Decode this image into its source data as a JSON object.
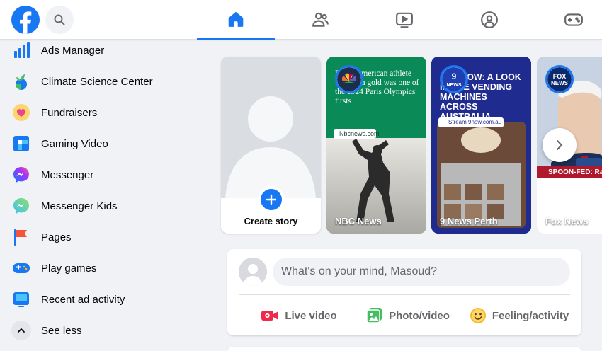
{
  "nav": {
    "tabs": [
      {
        "name": "home",
        "active": true,
        "icon": "home-icon"
      },
      {
        "name": "friends",
        "active": false,
        "icon": "friends-icon"
      },
      {
        "name": "watch",
        "active": false,
        "icon": "video-icon"
      },
      {
        "name": "groups",
        "active": false,
        "icon": "groups-icon"
      },
      {
        "name": "gaming",
        "active": false,
        "icon": "gamepad-icon"
      }
    ],
    "accent": "#1877f2"
  },
  "sidebar": {
    "items": [
      {
        "label": "Ads Manager",
        "icon": "ads-manager-icon"
      },
      {
        "label": "Climate Science Center",
        "icon": "climate-icon"
      },
      {
        "label": "Fundraisers",
        "icon": "fundraisers-icon"
      },
      {
        "label": "Gaming Video",
        "icon": "gaming-video-icon"
      },
      {
        "label": "Messenger",
        "icon": "messenger-icon"
      },
      {
        "label": "Messenger Kids",
        "icon": "messenger-kids-icon"
      },
      {
        "label": "Pages",
        "icon": "pages-flag-icon"
      },
      {
        "label": "Play games",
        "icon": "play-games-icon"
      },
      {
        "label": "Recent ad activity",
        "icon": "recent-ad-activity-icon"
      },
      {
        "label": "See less",
        "icon": "chevron-up-icon"
      }
    ]
  },
  "stories": {
    "create_label": "Create story",
    "items": [
      {
        "name": "NBC News",
        "headline": "Black American athlete who won gold was one of the 1924 Paris Olympics' firsts",
        "source": "Nbcnews.com"
      },
      {
        "name": "9 News Perth",
        "headline": "ON 9NOW: A LOOK INSIDE VENDING MACHINES ACROSS AUSTRALIA",
        "source": "Stream 9now.com.au"
      },
      {
        "name": "Fox News",
        "headline": "SPOON-FED: Radio host interviewed B... troubling b... scenes"
      }
    ]
  },
  "composer": {
    "placeholder": "What's on your mind, Masoud?",
    "actions": [
      {
        "label": "Live video",
        "color": "#f02849"
      },
      {
        "label": "Photo/video",
        "color": "#45bd62"
      },
      {
        "label": "Feeling/activity",
        "color": "#f7b928"
      }
    ]
  }
}
